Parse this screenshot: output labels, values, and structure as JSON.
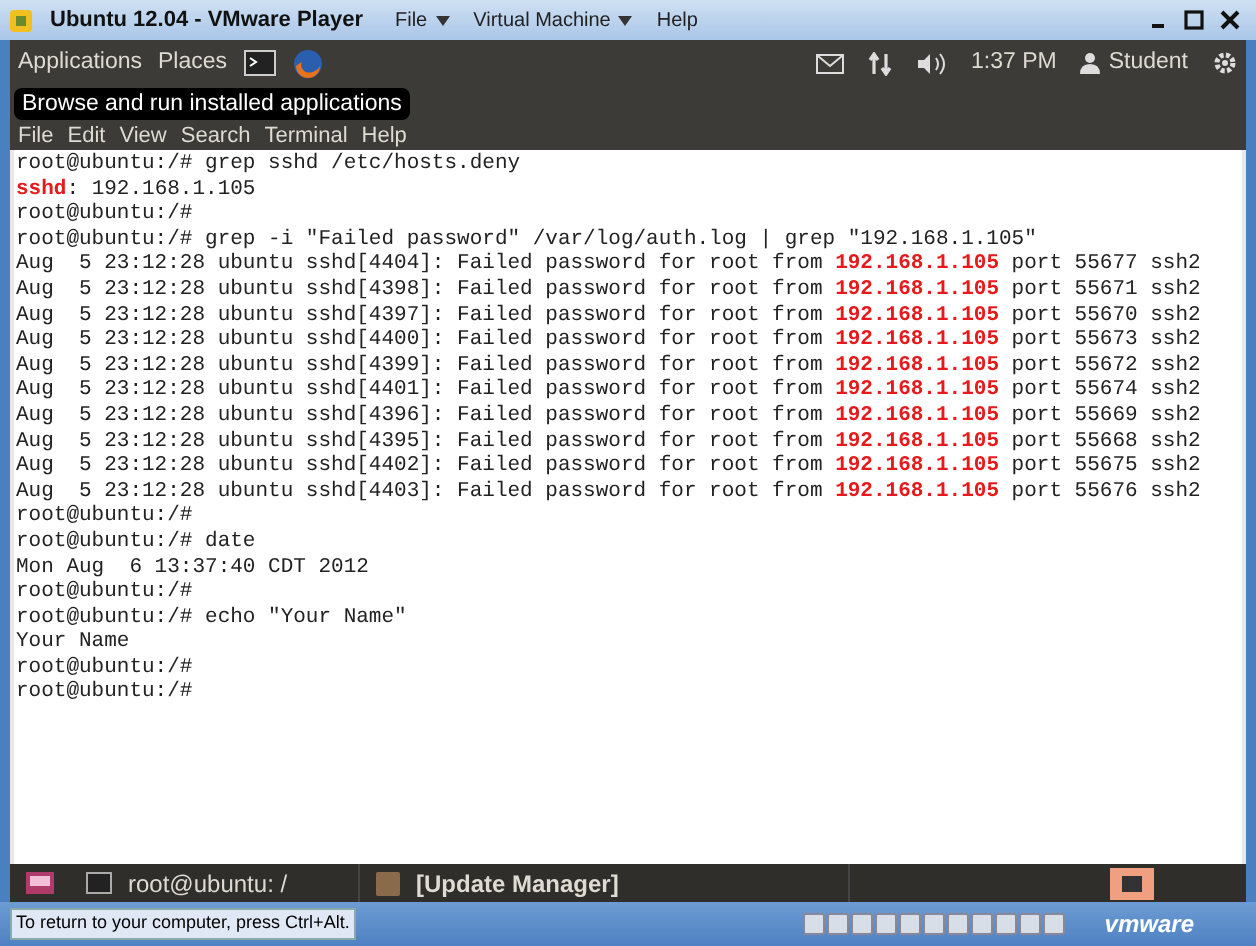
{
  "window": {
    "title": "Ubuntu 12.04 - VMware Player",
    "menu": [
      "File",
      "Virtual Machine",
      "Help"
    ]
  },
  "top_panel": {
    "menus": [
      "Applications",
      "Places"
    ],
    "clock": "1:37 PM",
    "user": "Student"
  },
  "tooltip": "Browse and run installed applications",
  "terminal_menu": [
    "File",
    "Edit",
    "View",
    "Search",
    "Terminal",
    "Help"
  ],
  "terminal_lines": [
    [
      {
        "text": "root@ubuntu:/# grep sshd /etc/hosts.deny",
        "highlight": false
      }
    ],
    [
      {
        "text": "sshd",
        "highlight": true
      },
      {
        "text": ": 192.168.1.105",
        "highlight": false
      }
    ],
    [
      {
        "text": "root@ubuntu:/#",
        "highlight": false
      }
    ],
    [
      {
        "text": "root@ubuntu:/# grep -i \"Failed password\" /var/log/auth.log | grep \"192.168.1.105\"",
        "highlight": false
      }
    ],
    [
      {
        "text": "Aug  5 23:12:28 ubuntu sshd[4404]: Failed password for root from ",
        "highlight": false
      },
      {
        "text": "192.168.1.105",
        "highlight": true
      },
      {
        "text": " port 55677 ssh2",
        "highlight": false
      }
    ],
    [
      {
        "text": "Aug  5 23:12:28 ubuntu sshd[4398]: Failed password for root from ",
        "highlight": false
      },
      {
        "text": "192.168.1.105",
        "highlight": true
      },
      {
        "text": " port 55671 ssh2",
        "highlight": false
      }
    ],
    [
      {
        "text": "Aug  5 23:12:28 ubuntu sshd[4397]: Failed password for root from ",
        "highlight": false
      },
      {
        "text": "192.168.1.105",
        "highlight": true
      },
      {
        "text": " port 55670 ssh2",
        "highlight": false
      }
    ],
    [
      {
        "text": "Aug  5 23:12:28 ubuntu sshd[4400]: Failed password for root from ",
        "highlight": false
      },
      {
        "text": "192.168.1.105",
        "highlight": true
      },
      {
        "text": " port 55673 ssh2",
        "highlight": false
      }
    ],
    [
      {
        "text": "Aug  5 23:12:28 ubuntu sshd[4399]: Failed password for root from ",
        "highlight": false
      },
      {
        "text": "192.168.1.105",
        "highlight": true
      },
      {
        "text": " port 55672 ssh2",
        "highlight": false
      }
    ],
    [
      {
        "text": "Aug  5 23:12:28 ubuntu sshd[4401]: Failed password for root from ",
        "highlight": false
      },
      {
        "text": "192.168.1.105",
        "highlight": true
      },
      {
        "text": " port 55674 ssh2",
        "highlight": false
      }
    ],
    [
      {
        "text": "Aug  5 23:12:28 ubuntu sshd[4396]: Failed password for root from ",
        "highlight": false
      },
      {
        "text": "192.168.1.105",
        "highlight": true
      },
      {
        "text": " port 55669 ssh2",
        "highlight": false
      }
    ],
    [
      {
        "text": "Aug  5 23:12:28 ubuntu sshd[4395]: Failed password for root from ",
        "highlight": false
      },
      {
        "text": "192.168.1.105",
        "highlight": true
      },
      {
        "text": " port 55668 ssh2",
        "highlight": false
      }
    ],
    [
      {
        "text": "Aug  5 23:12:28 ubuntu sshd[4402]: Failed password for root from ",
        "highlight": false
      },
      {
        "text": "192.168.1.105",
        "highlight": true
      },
      {
        "text": " port 55675 ssh2",
        "highlight": false
      }
    ],
    [
      {
        "text": "Aug  5 23:12:28 ubuntu sshd[4403]: Failed password for root from ",
        "highlight": false
      },
      {
        "text": "192.168.1.105",
        "highlight": true
      },
      {
        "text": " port 55676 ssh2",
        "highlight": false
      }
    ],
    [
      {
        "text": "root@ubuntu:/#",
        "highlight": false
      }
    ],
    [
      {
        "text": "root@ubuntu:/# date",
        "highlight": false
      }
    ],
    [
      {
        "text": "Mon Aug  6 13:37:40 CDT 2012",
        "highlight": false
      }
    ],
    [
      {
        "text": "root@ubuntu:/#",
        "highlight": false
      }
    ],
    [
      {
        "text": "root@ubuntu:/# echo \"Your Name\"",
        "highlight": false
      }
    ],
    [
      {
        "text": "Your Name",
        "highlight": false
      }
    ],
    [
      {
        "text": "root@ubuntu:/#",
        "highlight": false
      }
    ],
    [
      {
        "text": "root@ubuntu:/#",
        "highlight": false
      }
    ]
  ],
  "taskbar": [
    {
      "label": "root@ubuntu: /",
      "selected": false,
      "kind": "terminal"
    },
    {
      "label": "[Update Manager]",
      "selected": false,
      "kind": "app"
    }
  ],
  "status_bar": {
    "hint": "To return to your computer, press Ctrl+Alt.",
    "brand": "vmware"
  }
}
